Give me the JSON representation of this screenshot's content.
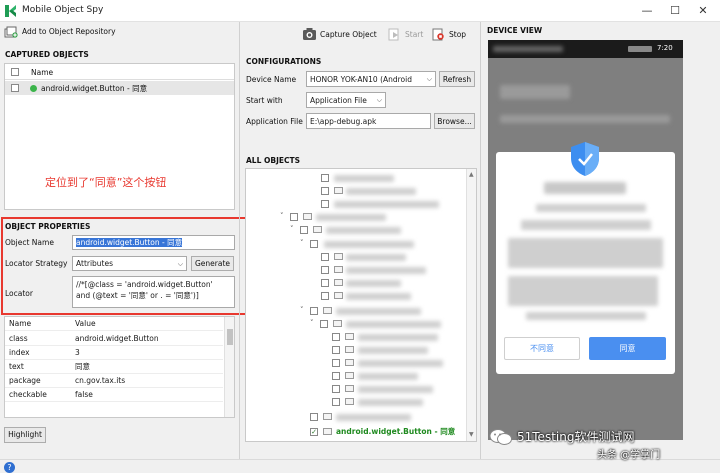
{
  "app": {
    "title": "Mobile Object Spy"
  },
  "toolbar": {
    "add_repo": "Add to Object Repository",
    "capture": "Capture Object",
    "start": "Start",
    "stop": "Stop"
  },
  "captured": {
    "heading": "CAPTURED OBJECTS",
    "col_name": "Name",
    "item": "android.widget.Button - 同意",
    "annotation": "定位到了“同意”这个按钮"
  },
  "props": {
    "heading": "OBJECT PROPERTIES",
    "object_name_label": "Object Name",
    "object_name_value": "android.widget.Button - 同意",
    "strategy_label": "Locator Strategy",
    "strategy_value": "Attributes",
    "generate": "Generate",
    "locator_label": "Locator",
    "locator_line1": "//*[@class = 'android.widget.Button'",
    "locator_line2": "and (@text = '同意' or . = '同意')]",
    "table_headers": [
      "Name",
      "Value"
    ],
    "rows": [
      {
        "name": "class",
        "value": "android.widget.Button"
      },
      {
        "name": "index",
        "value": "3"
      },
      {
        "name": "text",
        "value": "同意"
      },
      {
        "name": "package",
        "value": "cn.gov.tax.its"
      },
      {
        "name": "checkable",
        "value": "false"
      }
    ],
    "highlight": "Highlight"
  },
  "config": {
    "heading": "CONFIGURATIONS",
    "device_label": "Device Name",
    "device_value": "HONOR YOK-AN10 (Android",
    "refresh": "Refresh",
    "start_with_label": "Start with",
    "start_with_value": "Application File",
    "app_file_label": "Application File",
    "app_file_value": "E:\\app-debug.apk",
    "browse": "Browse..."
  },
  "all_objects": {
    "heading": "ALL OBJECTS",
    "selected": "android.widget.Button - 同意"
  },
  "device": {
    "heading": "DEVICE VIEW",
    "status_time": "7:20",
    "disagree": "不同意",
    "agree": "同意",
    "accent": "#4a8ff0"
  },
  "watermark": {
    "line1": "51Testing软件测试网",
    "line2": "头条 @学掌门"
  }
}
